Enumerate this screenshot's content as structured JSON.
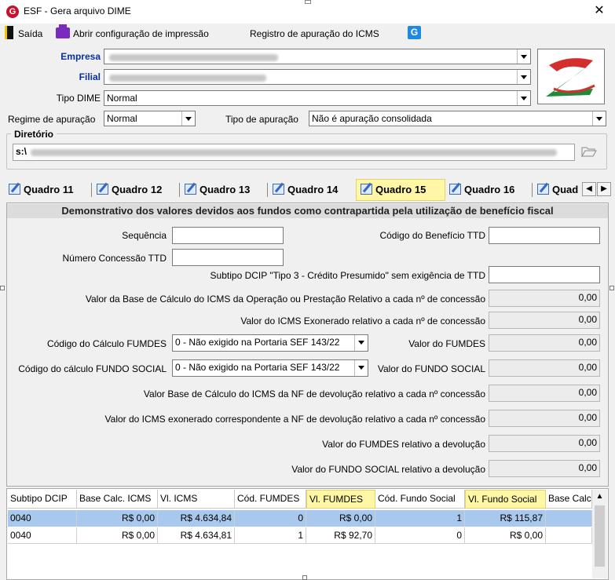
{
  "window": {
    "title": "ESF - Gera arquivo DIME",
    "app_icon": "G",
    "close": "✕"
  },
  "menu": {
    "exit": "Saída",
    "print_config": "Abrir configuração de impressão",
    "icms_register": "Registro de apuração do ICMS"
  },
  "header": {
    "empresa_label": "Empresa",
    "filial_label": "Filial",
    "tipo_dime_label": "Tipo DIME",
    "tipo_dime_value": "Normal",
    "regime_label": "Regime de apuração",
    "regime_value": "Normal",
    "tipo_apuracao_label": "Tipo de apuração",
    "tipo_apuracao_value": "Não é apuração consolidada",
    "diretorio_label": "Diretório",
    "diretorio_prefix": "s:\\"
  },
  "tabs": [
    {
      "label": "Quadro 11"
    },
    {
      "label": "Quadro 12"
    },
    {
      "label": "Quadro 13"
    },
    {
      "label": "Quadro 14"
    },
    {
      "label": "Quadro 15"
    },
    {
      "label": "Quadro 16"
    },
    {
      "label": "Quad"
    }
  ],
  "panel": {
    "title": "Demonstrativo dos valores devidos aos fundos como contrapartida pela utilização de benefício fiscal",
    "sequencia_label": "Sequência",
    "codigo_beneficio_label": "Código do Benefício TTD",
    "numero_concessao_label": "Número Concessão TTD",
    "subtipo_label": "Subtipo DCIP \"Tipo 3 - Crédito Presumido\" sem exigência de TTD",
    "base_calculo_label": "Valor da Base de Cálculo do ICMS da Operação ou Prestação Relativo a cada nº de concessão",
    "base_calculo_value": "0,00",
    "icms_exonerado_label": "Valor do ICMS Exonerado relativo a cada nº de concessão",
    "icms_exonerado_value": "0,00",
    "cod_fumdes_label": "Código do Cálculo FUMDES",
    "cod_fumdes_value": "0 - Não exigido na Portaria SEF 143/22",
    "valor_fumdes_label": "Valor do FUMDES",
    "valor_fumdes_value": "0,00",
    "cod_fundo_social_label": "Código do cálculo FUNDO SOCIAL",
    "cod_fundo_social_value": "0 - Não exigido na Portaria SEF 143/22",
    "valor_fundo_social_label": "Valor do FUNDO SOCIAL",
    "valor_fundo_social_value": "0,00",
    "base_nf_devolucao_label": "Valor Base de Cálculo do ICMS da NF de devolução relativo a cada nº concessão",
    "base_nf_devolucao_value": "0,00",
    "icms_exonerado_nf_label": "Valor do ICMS exonerado correspondente a NF de devolução relativo a cada nº concessão",
    "icms_exonerado_nf_value": "0,00",
    "fumdes_devolucao_label": "Valor do FUMDES relativo a devolução",
    "fumdes_devolucao_value": "0,00",
    "fundo_social_devolucao_label": "Valor do FUNDO SOCIAL relativo a devolução",
    "fundo_social_devolucao_value": "0,00"
  },
  "grid": {
    "columns": [
      "Subtipo DCIP",
      "Base Calc. ICMS",
      "Vl. ICMS",
      "Cód. FUMDES",
      "Vl. FUMDES",
      "Cód. Fundo Social",
      "Vl. Fundo Social",
      "Base Calc"
    ],
    "rows": [
      [
        "0040",
        "R$ 0,00",
        "R$ 4.634,84",
        "0",
        "R$ 0,00",
        "1",
        "R$ 115,87"
      ],
      [
        "0040",
        "R$ 0,00",
        "R$ 4.634,81",
        "1",
        "R$ 92,70",
        "0",
        "R$ 0,00"
      ]
    ]
  },
  "colors": {
    "label_blue": "#0a2f9e",
    "highlight": "#fff7a6",
    "selected_row": "#a9c8ee",
    "logo_red": "#d32f2f",
    "logo_green": "#1f8a3a"
  }
}
